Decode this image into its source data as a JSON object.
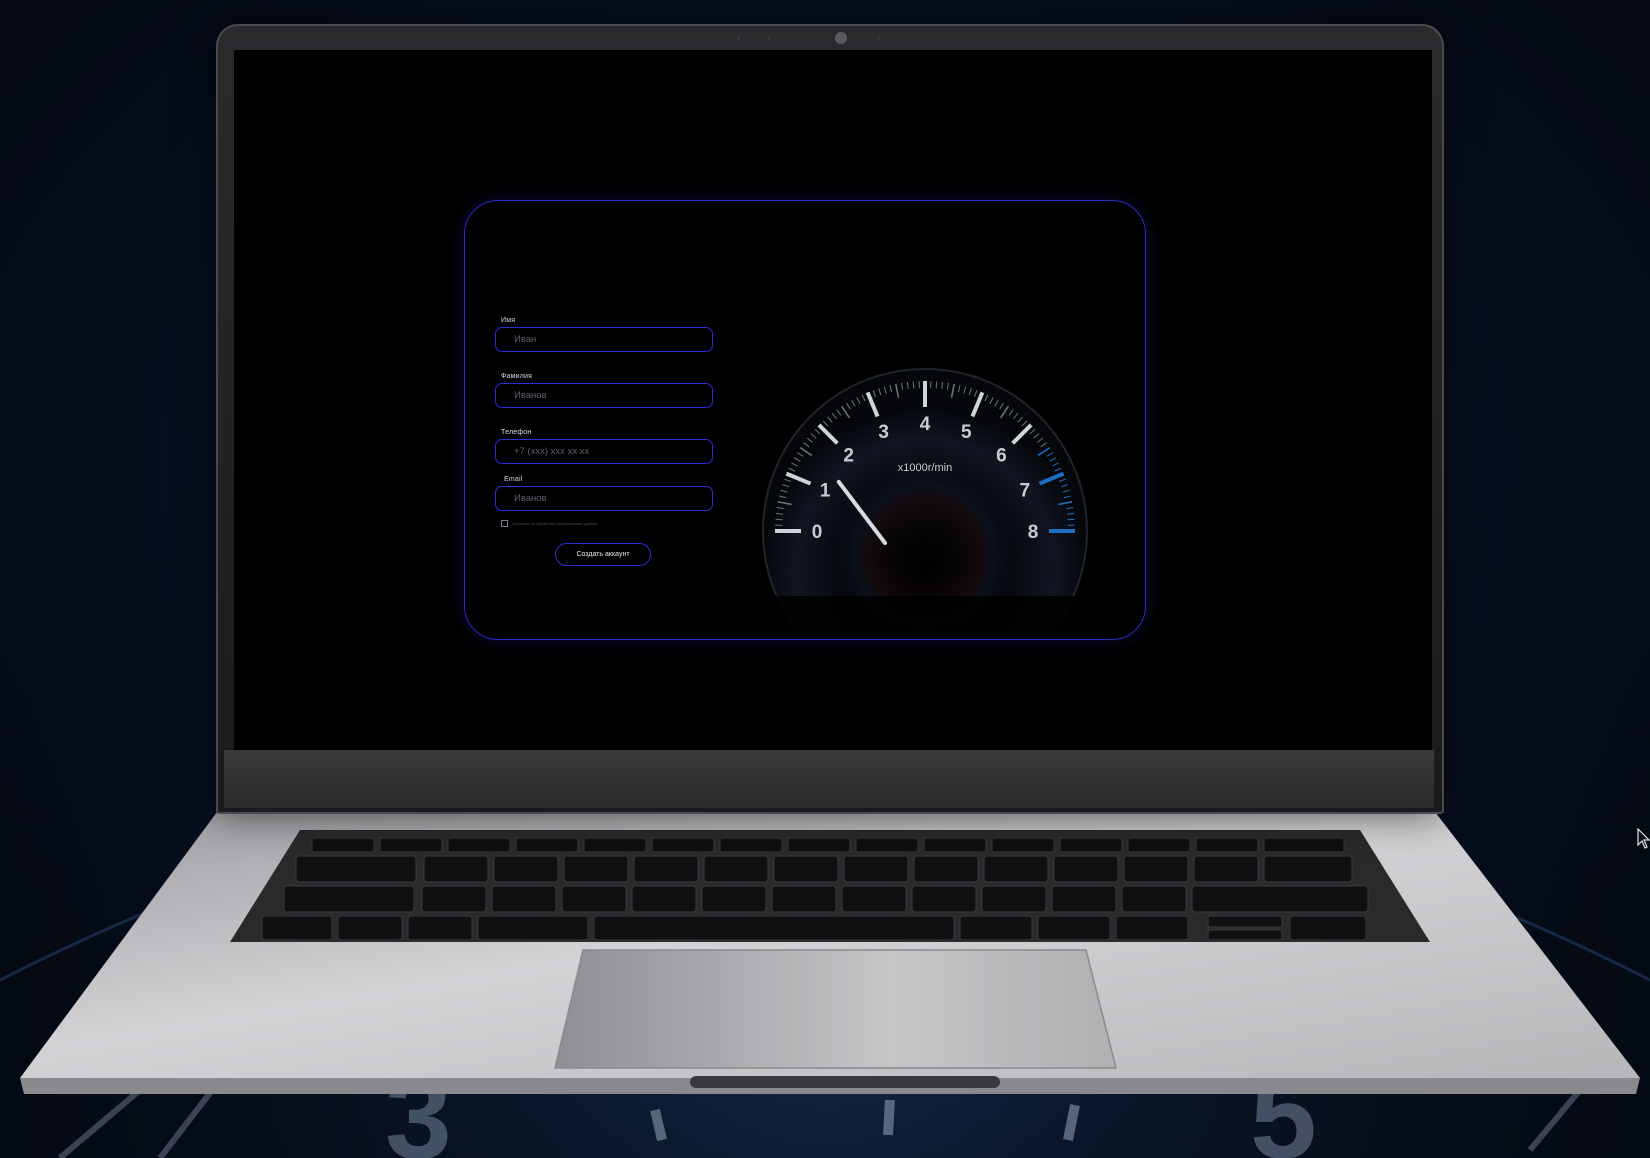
{
  "form": {
    "first_name": {
      "label": "Имя",
      "placeholder": "Иван"
    },
    "last_name": {
      "label": "Фамилия",
      "placeholder": "Иванов"
    },
    "phone": {
      "label": "Телефон",
      "placeholder": "+7 (xxx) xxx xx xx"
    },
    "email": {
      "label": "Email",
      "placeholder": "Иванов"
    },
    "consent_text": "Согласие на обработку персональных данных",
    "submit_label": "Создать аккаунт"
  },
  "tachometer": {
    "unit": "x1000r/min",
    "ticks": [
      "0",
      "1",
      "2",
      "3",
      "4",
      "5",
      "6",
      "7",
      "8"
    ],
    "needle_value": 0.7,
    "max_value": 8
  },
  "background_gauge_digits": [
    "3",
    "5"
  ],
  "colors": {
    "accent": "#2b2ed6",
    "background": "#000000",
    "tacho_redline": "#1e6fc0"
  }
}
